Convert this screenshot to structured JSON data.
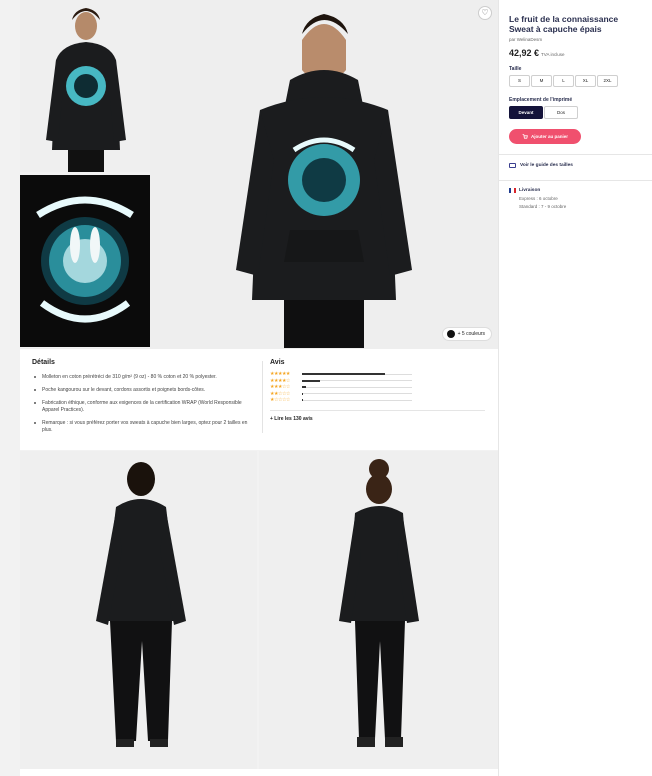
{
  "product": {
    "title": "Le fruit de la connaissance Sweat à capuche épais",
    "by": "par WelinaDesm",
    "price": "42,92 €",
    "tva": "TVA incluse"
  },
  "size": {
    "label": "Taille",
    "options": [
      "S",
      "M",
      "L",
      "XL",
      "2XL"
    ]
  },
  "placement": {
    "label": "Emplacement de l'imprimé",
    "options": [
      "Devant",
      "Dos"
    ],
    "selected": "Devant"
  },
  "cart": {
    "label": "Ajouter au panier"
  },
  "guide": {
    "label": "Voir le guide des tailles"
  },
  "shipping": {
    "label": "Livraison",
    "express": "Express : 6 octobre",
    "standard": "Standard : 7 - 9 octobre",
    "flag_colors": [
      "#1f3c8f",
      "#ffffff",
      "#d8232a"
    ]
  },
  "gallery": {
    "colors_label": "+ 5 couleurs",
    "fav_icon": "heart-icon"
  },
  "details": {
    "title": "Détails",
    "items": [
      "Molleton en coton prérétréci de 310 g/m² (9 oz) - 80 % coton et 20 % polyester.",
      "Poche kangourou sur le devant, cordons assortis et poignets bords-côtes.",
      "Fabrication éthique, conforme aux exigences de la certification WRAP (World Responsible Apparel Practices).",
      "Remarque : si vous préférez porter vos sweats à capuche bien larges, optez pour 2 tailles en plus."
    ]
  },
  "reviews": {
    "title": "Avis",
    "rows": [
      {
        "stars": "★★★★★",
        "fraction": 0.75
      },
      {
        "stars": "★★★★☆",
        "fraction": 0.16
      },
      {
        "stars": "★★★☆☆",
        "fraction": 0.04
      },
      {
        "stars": "★★☆☆☆",
        "fraction": 0.01
      },
      {
        "stars": "★☆☆☆☆",
        "fraction": 0.01
      }
    ],
    "link": "+ Lire les 130 avis"
  },
  "colors": {
    "accent": "#f0506e",
    "navy": "#14133a",
    "star": "#f5a623",
    "hoodie": "#1b1c1e",
    "print": "#4fd3e0"
  }
}
